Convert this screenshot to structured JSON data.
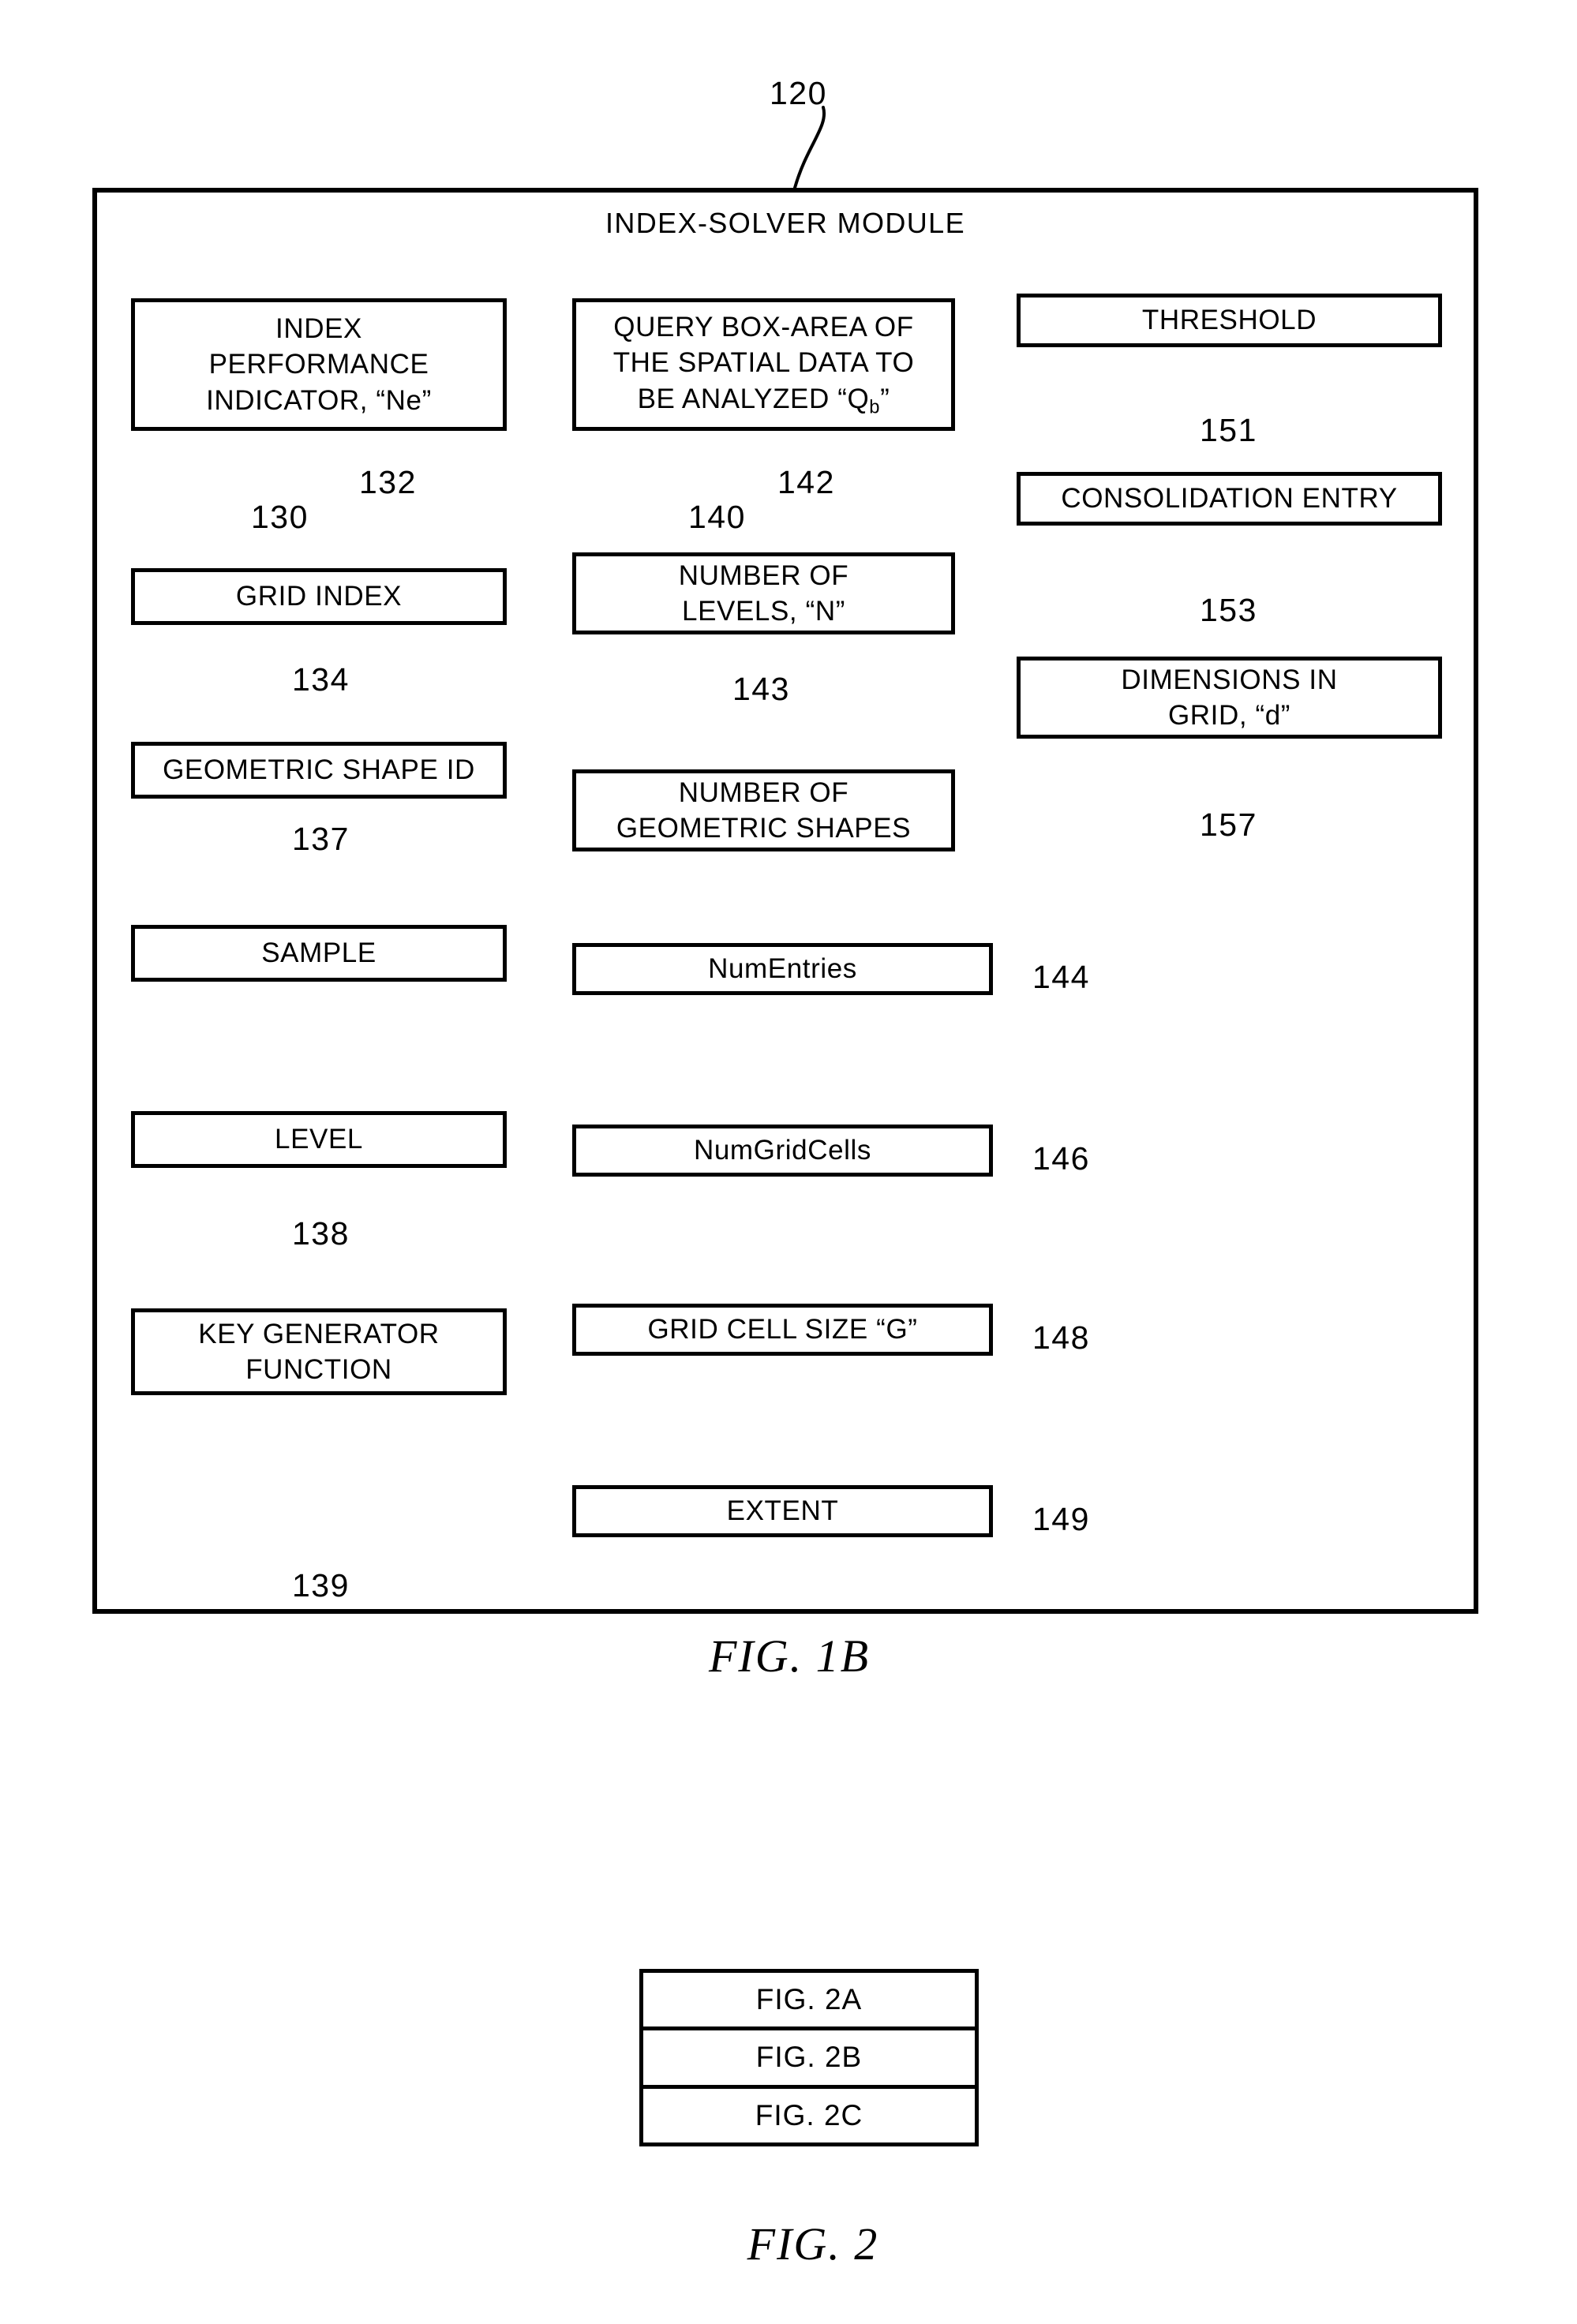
{
  "figure_1b": {
    "module_ref": "120",
    "module_title": "INDEX-SOLVER MODULE",
    "caption": "FIG.  1B",
    "columns": {
      "left": [
        {
          "label": "INDEX\nPERFORMANCE\nINDICATOR, “Ne”",
          "ref": "130",
          "ref2": "132"
        },
        {
          "label": "GRID INDEX",
          "ref": "134"
        },
        {
          "label": "GEOMETRIC SHAPE ID",
          "ref": "137"
        },
        {
          "label": "SAMPLE",
          "ref": ""
        },
        {
          "label": "LEVEL",
          "ref": "138"
        },
        {
          "label": "KEY GENERATOR\nFUNCTION",
          "ref": "139"
        }
      ],
      "middle": [
        {
          "label": "QUERY BOX-AREA OF\nTHE SPATIAL DATA TO\nBE ANALYZED “Qb”",
          "ref": "140",
          "ref2": "142"
        },
        {
          "label": "NUMBER OF\nLEVELS, “N”",
          "ref": "143"
        },
        {
          "label": "NUMBER OF\nGEOMETRIC SHAPES",
          "ref": ""
        },
        {
          "label": "NumEntries",
          "ref": "144"
        },
        {
          "label": "NumGridCells",
          "ref": "146"
        },
        {
          "label": "GRID CELL SIZE “G”",
          "ref": "148"
        },
        {
          "label": "EXTENT",
          "ref": "149"
        }
      ],
      "right": [
        {
          "label": "THRESHOLD",
          "ref": "151"
        },
        {
          "label": "CONSOLIDATION ENTRY",
          "ref": "153"
        },
        {
          "label": "DIMENSIONS IN\nGRID, “d”",
          "ref": "157"
        }
      ]
    }
  },
  "figure_2": {
    "caption": "FIG.  2",
    "rows": [
      "FIG. 2A",
      "FIG. 2B",
      "FIG. 2C"
    ]
  },
  "node_text": {
    "index_perf_line1": "INDEX",
    "index_perf_line2": "PERFORMANCE",
    "index_perf_line3": "INDICATOR, “Ne”",
    "grid_index": "GRID INDEX",
    "geometric_shape_id": "GEOMETRIC SHAPE ID",
    "sample": "SAMPLE",
    "level": "LEVEL",
    "key_gen_line1": "KEY GENERATOR",
    "key_gen_line2": "FUNCTION",
    "query_box_line1": "QUERY BOX-AREA OF",
    "query_box_line2": "THE SPATIAL DATA TO",
    "query_box_line3_pre": "BE ANALYZED “Q",
    "query_box_line3_sub": "b",
    "query_box_line3_post": "”",
    "num_levels_line1": "NUMBER OF",
    "num_levels_line2": "LEVELS, “N”",
    "num_shapes_line1": "NUMBER OF",
    "num_shapes_line2": "GEOMETRIC SHAPES",
    "num_entries": "NumEntries",
    "num_grid_cells": "NumGridCells",
    "grid_cell_size": "GRID CELL SIZE “G”",
    "extent": "EXTENT",
    "threshold": "THRESHOLD",
    "consolidation_entry": "CONSOLIDATION ENTRY",
    "dimensions_line1": "DIMENSIONS IN",
    "dimensions_line2": "GRID, “d”"
  },
  "refs": {
    "r120": "120",
    "r130": "130",
    "r132": "132",
    "r134": "134",
    "r137": "137",
    "r138": "138",
    "r139": "139",
    "r140": "140",
    "r142": "142",
    "r143": "143",
    "r144": "144",
    "r146": "146",
    "r148": "148",
    "r149": "149",
    "r151": "151",
    "r153": "153",
    "r157": "157"
  },
  "colors": {
    "ink": "#000000",
    "paper": "#ffffff"
  }
}
